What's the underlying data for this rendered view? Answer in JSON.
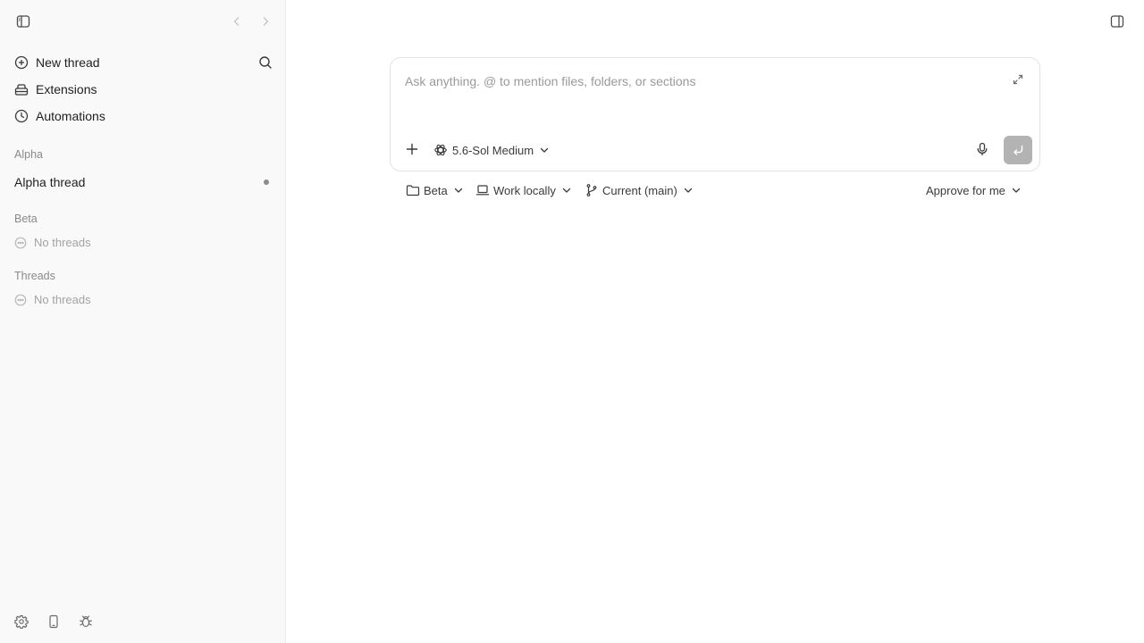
{
  "sidebar": {
    "nav": [
      {
        "label": "New thread",
        "icon": "plus-circle-icon"
      },
      {
        "label": "Extensions",
        "icon": "extensions-icon"
      },
      {
        "label": "Automations",
        "icon": "clock-icon"
      }
    ],
    "sections": [
      {
        "label": "Alpha",
        "threads": [
          {
            "label": "Alpha thread"
          }
        ]
      },
      {
        "label": "Beta",
        "empty_label": "No threads"
      },
      {
        "label": "Threads",
        "empty_label": "No threads"
      }
    ]
  },
  "composer": {
    "placeholder": "Ask anything. @ to mention files, folders, or sections",
    "model_label": "5.6-Sol Medium"
  },
  "controls": {
    "project_label": "Beta",
    "environment_label": "Work locally",
    "branch_label": "Current (main)",
    "approval_label": "Approve for me"
  },
  "colors": {
    "sidebar_bg": "#f9f9f9",
    "send_button": "#b3b3b3",
    "muted_text": "#a3a3a3"
  }
}
